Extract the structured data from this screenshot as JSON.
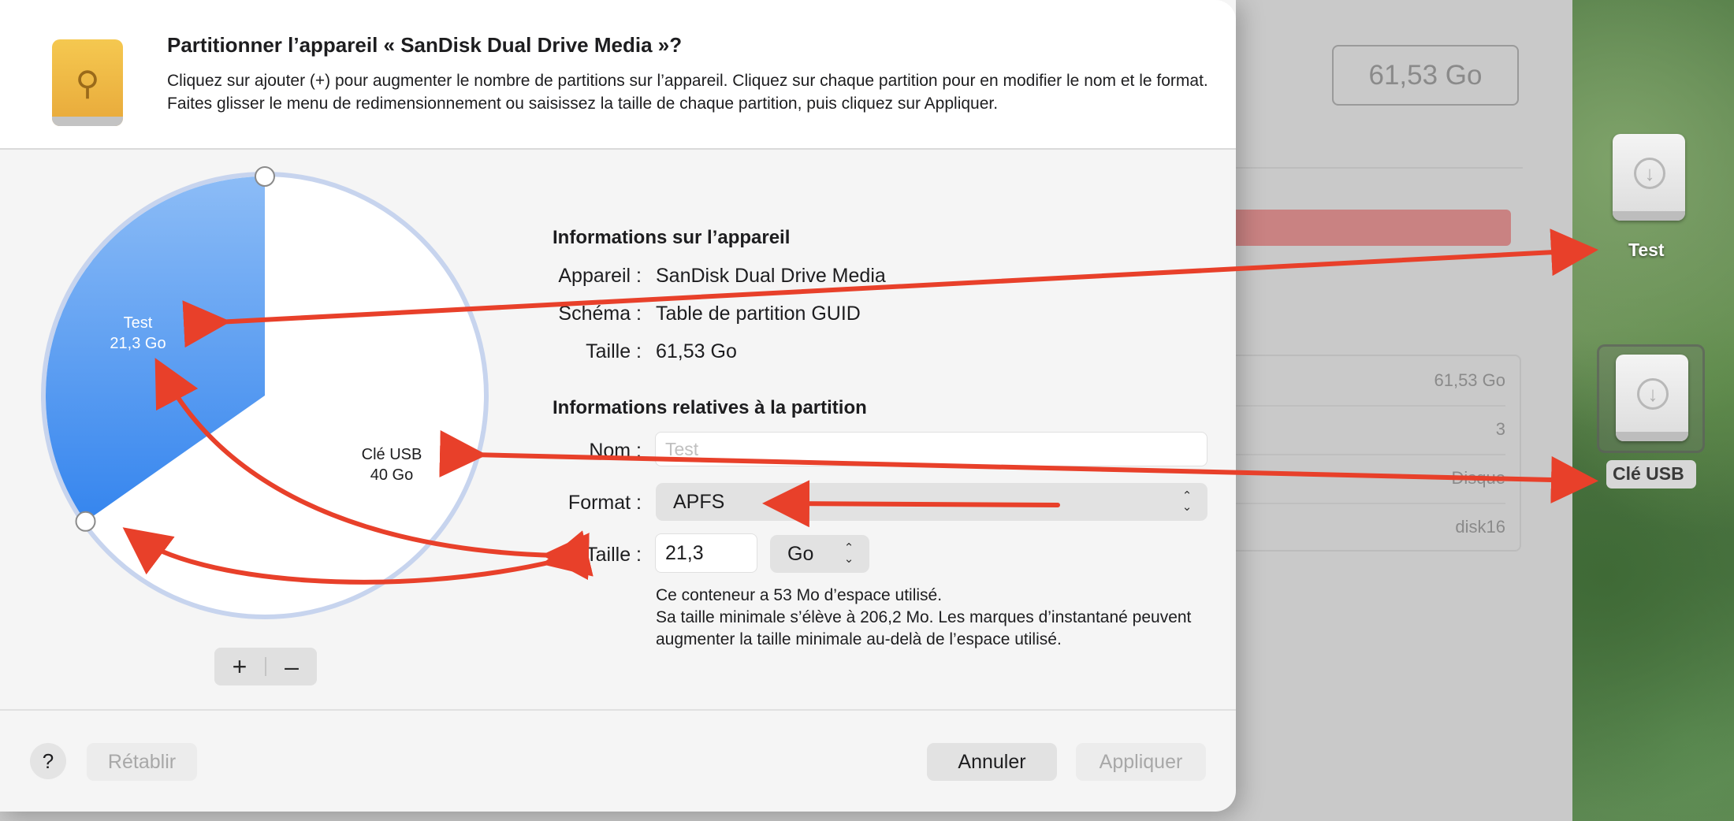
{
  "background": {
    "size_box": "61,53 Go",
    "table_rows": [
      "61,53 Go",
      "3",
      "Disque",
      "disk16"
    ]
  },
  "desktop": {
    "drive1": {
      "label": "Test",
      "icon": "download-circle-icon"
    },
    "drive2": {
      "label": "Clé USB",
      "icon": "download-circle-icon"
    }
  },
  "dialog": {
    "title": "Partitionner l’appareil « SanDisk Dual Drive Media »?",
    "description": "Cliquez sur ajouter (+) pour augmenter le nombre de partitions sur l’appareil. Cliquez sur chaque partition pour en modifier le nom et le format. Faites glisser le menu de redimensionnement ou saisissez la taille de chaque partition, puis cliquez sur Appliquer.",
    "device_info": {
      "heading": "Informations sur l’appareil",
      "device_label": "Appareil :",
      "device_value": "SanDisk Dual Drive Media",
      "scheme_label": "Schéma :",
      "scheme_value": "Table de partition GUID",
      "size_label": "Taille :",
      "size_value": "61,53 Go"
    },
    "partition_info": {
      "heading": "Informations relatives à la partition",
      "name_label": "Nom :",
      "name_placeholder": "Test",
      "format_label": "Format :",
      "format_value": "APFS",
      "size_label": "Taille :",
      "size_value": "21,3",
      "unit_value": "Go",
      "note_line1": "Ce conteneur a 53 Mo d’espace utilisé.",
      "note_line2": "Sa taille minimale s’élève à 206,2 Mo. Les marques d’instantané peuvent augmenter la taille minimale au-delà de l’espace utilisé."
    },
    "pie": {
      "total_gb": 61.3,
      "partitions": [
        {
          "name": "Test",
          "size": "21,3 Go",
          "gb": 21.3,
          "color": "#4f95f0",
          "selected": true
        },
        {
          "name": "Clé USB",
          "size": "40 Go",
          "gb": 40,
          "color": "#ffffff",
          "selected": false
        }
      ]
    },
    "buttons": {
      "add": "+",
      "remove": "–",
      "help": "?",
      "revert": "Rétablir",
      "cancel": "Annuler",
      "apply": "Appliquer"
    }
  },
  "colors": {
    "annotation_arrow": "#e8402a",
    "accent_blue": "#4f95f0"
  }
}
